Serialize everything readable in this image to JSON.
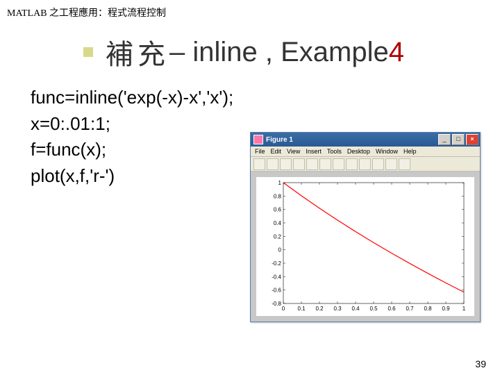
{
  "breadcrumb": "MATLAB 之工程應用：程式流程控制",
  "title": {
    "cjk": "補充",
    "latin": " – inline , Example ",
    "colored": "4"
  },
  "code": {
    "l1": "func=inline('exp(-x)-x','x');",
    "l2": "x=0:.01:1;",
    "l3": "f=func(x);",
    "l4": "plot(x,f,'r-')"
  },
  "figwin": {
    "title": "Figure 1",
    "menu": [
      "File",
      "Edit",
      "View",
      "Insert",
      "Tools",
      "Desktop",
      "Window",
      "Help"
    ],
    "btn_min": "_",
    "btn_max": "□",
    "btn_close": "×"
  },
  "chart_data": {
    "type": "line",
    "title": "",
    "xlabel": "",
    "ylabel": "",
    "xlim": [
      0,
      1
    ],
    "ylim": [
      -0.8,
      1
    ],
    "xticks": [
      0,
      0.1,
      0.2,
      0.3,
      0.4,
      0.5,
      0.6,
      0.7,
      0.8,
      0.9,
      1
    ],
    "yticks": [
      -0.8,
      -0.6,
      -0.4,
      -0.2,
      0,
      0.2,
      0.4,
      0.6,
      0.8,
      1
    ],
    "series": [
      {
        "name": "exp(-x)-x",
        "color": "#ff0000",
        "x": [
          0.0,
          0.1,
          0.2,
          0.3,
          0.4,
          0.5,
          0.6,
          0.7,
          0.8,
          0.9,
          1.0
        ],
        "y": [
          1.0,
          0.8048,
          0.6187,
          0.4408,
          0.2703,
          0.1065,
          -0.0512,
          -0.2034,
          -0.3507,
          -0.4934,
          -0.6321
        ]
      }
    ]
  },
  "page": "39"
}
